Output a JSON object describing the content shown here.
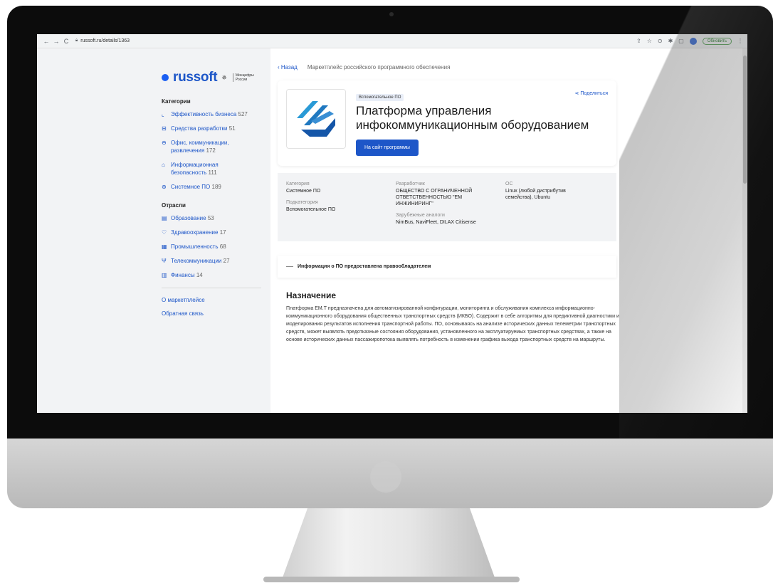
{
  "browser": {
    "url": "russoft.ru/details/1363",
    "update_label": "Обновить"
  },
  "sidebar": {
    "logo": "russoft",
    "ministry_line1": "Минцифры",
    "ministry_line2": "России",
    "categories_heading": "Категории",
    "categories": [
      {
        "label": "Эффективность бизнеса",
        "count": "527"
      },
      {
        "label": "Средства разработки",
        "count": "51"
      },
      {
        "label": "Офис, коммуникации, развлечения",
        "count": "172"
      },
      {
        "label": "Информационная безопасность",
        "count": "111"
      },
      {
        "label": "Системное ПО",
        "count": "189"
      }
    ],
    "industries_heading": "Отрасли",
    "industries": [
      {
        "label": "Образование",
        "count": "53"
      },
      {
        "label": "Здравоохранение",
        "count": "17"
      },
      {
        "label": "Промышленность",
        "count": "68"
      },
      {
        "label": "Телекоммуникации",
        "count": "27"
      },
      {
        "label": "Финансы",
        "count": "14"
      }
    ],
    "about": "О маркетплейсе",
    "feedback": "Обратная связь"
  },
  "main": {
    "back": "‹ Назад",
    "breadcrumb": "Маркетплейс российского программного обеспечения",
    "tag": "Вспомогательное ПО",
    "title": "Платформа управления инфокоммуникационным оборудованием",
    "cta": "На сайт программы",
    "share": "Поделиться",
    "category_label": "Категория",
    "category_value": "Системное ПО",
    "subcategory_label": "Подкатегория",
    "subcategory_value": "Вспомогательное ПО",
    "developer_label": "Разработчик",
    "developer_value": "ОБЩЕСТВО С ОГРАНИЧЕННОЙ ОТВЕТСТВЕННОСТЬЮ \"ЕМ ИНЖИНИРИНГ\"",
    "analogs_label": "Зарубежные аналоги",
    "analogs_value": "NimBus, NaviFleet, DILAX Citisense",
    "os_label": "ОС",
    "os_value": "Linux (любой дистрибутив семейства), Ubuntu",
    "notice": "Информация о ПО предоставлена правообладателем",
    "section_title": "Назначение",
    "description": "Платформа ЕМ.Т предназначена для автоматизированной конфигурации, мониторинга и обслуживания комплекса информационно-коммуникационного оборудования общественных транспортных средств (ИКБО). Содержит в себе алгоритмы для предиктивной диагностики и моделирования результатов исполнения транспортной работы. ПО, основываясь на анализе исторических данных телеметрии транспортных средств, может выявлять предотказные состояния оборудования, установленного на эксплуатируемых транспортных средствах, а также на основе исторических данных пассажиропотока выявлять потребность в изменении графика выхода транспортных средств на маршруты."
  },
  "colors": {
    "accent": "#1d56c8",
    "sidebar_bg": "#f2f3f5"
  }
}
